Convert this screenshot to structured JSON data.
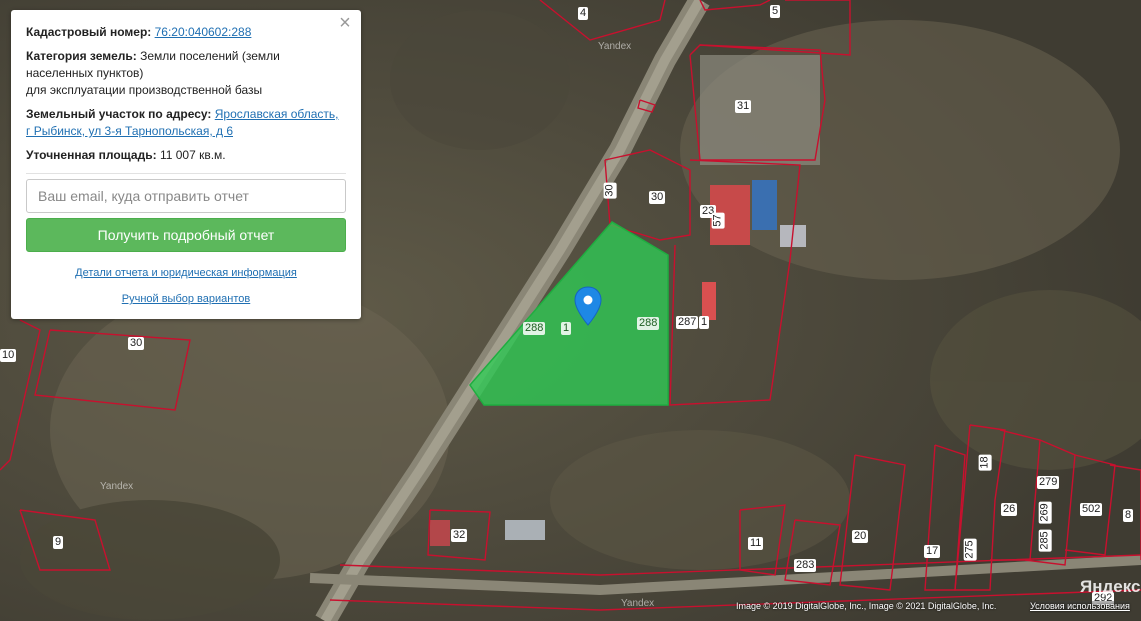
{
  "popup": {
    "close_icon": "close-icon",
    "cadastral_label": "Кадастровый номер:",
    "cadastral_number": "76:20:040602:288",
    "category_label": "Категория земель:",
    "category_value": "Земли поселений (земли населенных пунктов)",
    "category_use": "для эксплуатации производственной базы",
    "address_label": "Земельный участок по адресу:",
    "address_value": "Ярославская область, г Рыбинск, ул 3-я Тарнопольская, д 6",
    "area_label": "Уточненная площадь:",
    "area_value": "11 007 кв.м.",
    "email_placeholder": "Ваш email, куда отправить отчет",
    "email_value": "",
    "report_button": "Получить подробный отчет",
    "details_link": "Детали отчета и юридическая информация",
    "manual_link": "Ручной выбор вариантов"
  },
  "map": {
    "selected_plot_color": "#2ecc55",
    "boundary_color": "#c8102e",
    "marker_color": "#1e88e5",
    "marker_icon": "map-pin-icon",
    "plot_labels": [
      "4",
      "5",
      "31",
      "30",
      "30",
      "23",
      "57",
      "288",
      "1",
      "288",
      "287",
      "1",
      "30",
      "10",
      "32",
      "11",
      "283",
      "20",
      "17",
      "275",
      "18",
      "26",
      "269",
      "285",
      "279",
      "502",
      "8",
      "292",
      "9"
    ],
    "watermarks": [
      "Yandex",
      "Yandex",
      "Yandex"
    ],
    "logo": "Яндекс",
    "attribution": "Image © 2019 DigitalGlobe, Inc., Image © 2021 DigitalGlobe, Inc.",
    "terms_link": "Условия использования"
  }
}
